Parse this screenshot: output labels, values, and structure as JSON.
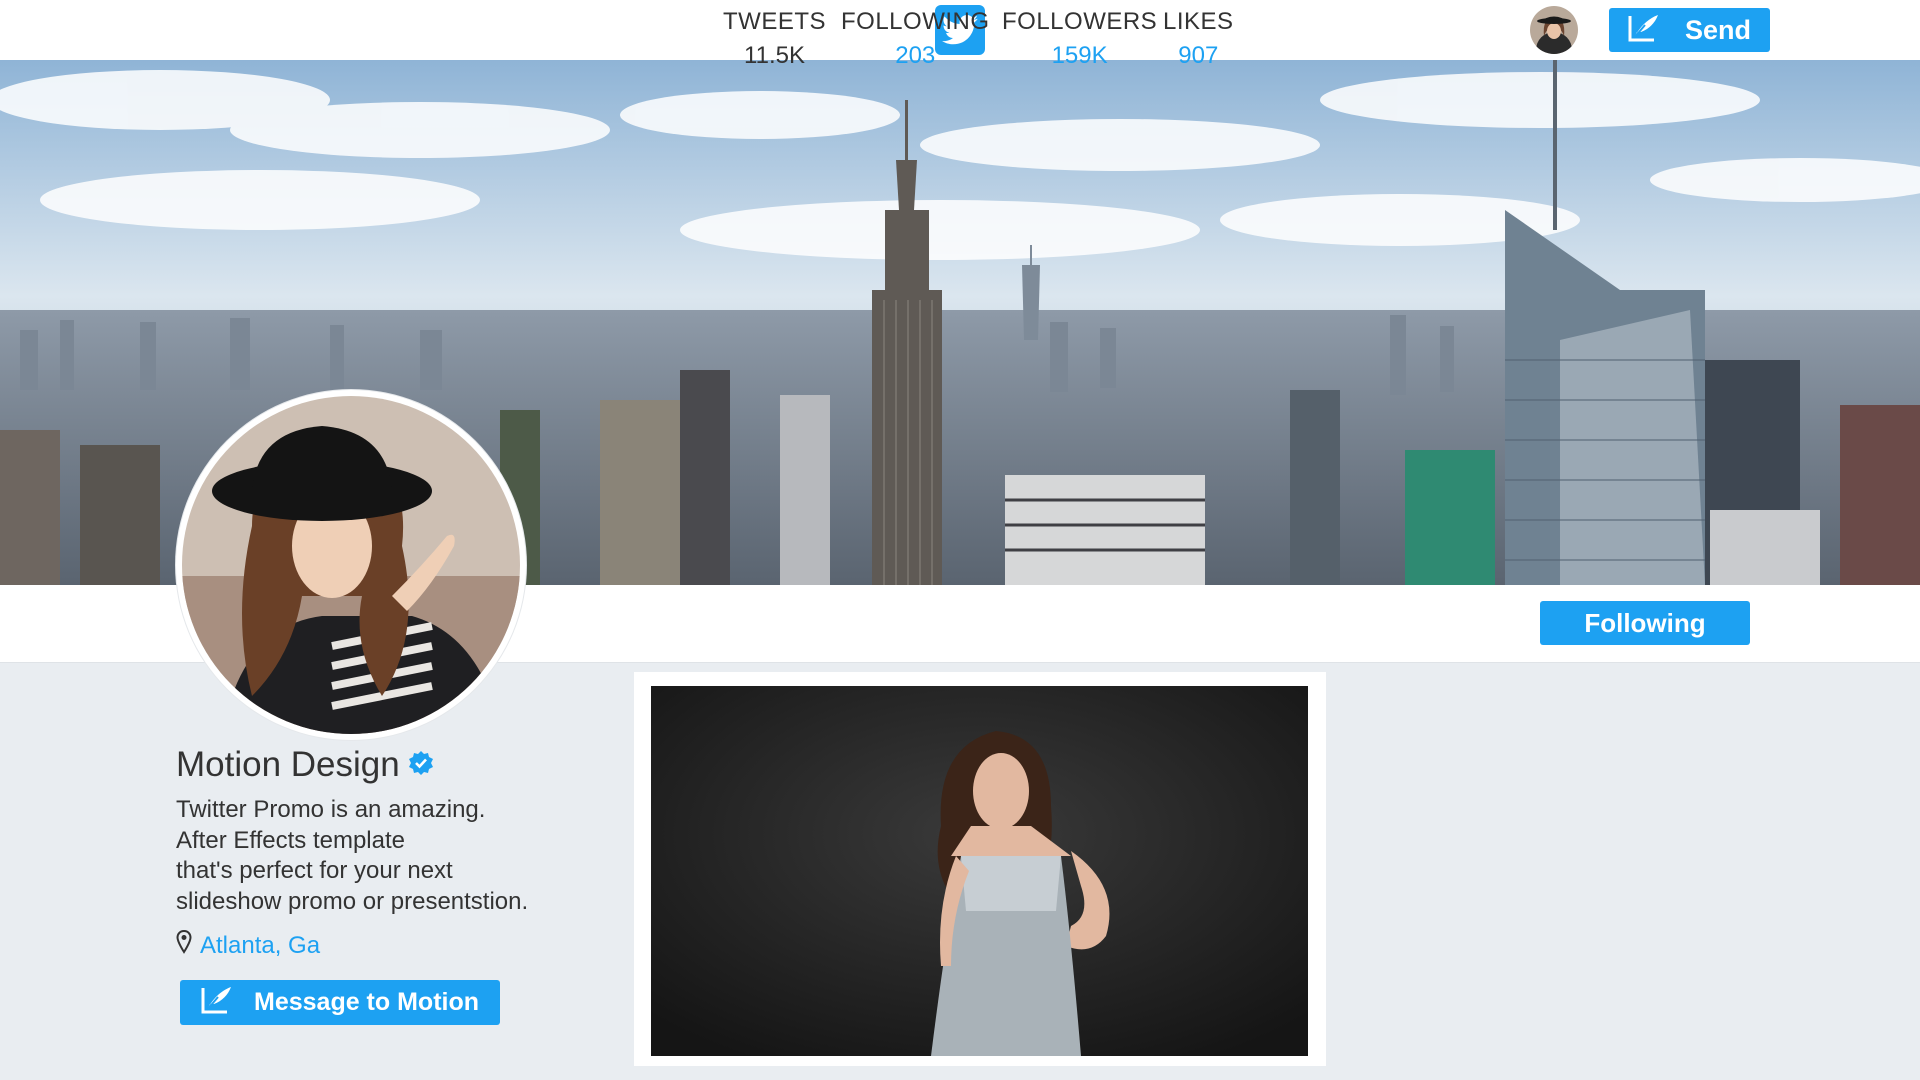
{
  "header": {
    "logo_icon": "twitter-bird-icon",
    "send_label": "Send",
    "send_icon": "compose-feather-icon",
    "avatar_icon": "user-avatar"
  },
  "stats": [
    {
      "label": "TWEETS",
      "value": "11.5K"
    },
    {
      "label": "FOLLOWING",
      "value": "203"
    },
    {
      "label": "FOLLOWERS",
      "value": "159K"
    },
    {
      "label": "LIKES",
      "value": "907"
    }
  ],
  "follow_button": {
    "label": "Following"
  },
  "profile": {
    "name": "Motion Design",
    "verified_icon": "verified-badge-icon",
    "bio": [
      "Twitter Promo is an amazing.",
      "After Effects template",
      "that's perfect for your next",
      "slideshow promo or presentstion."
    ],
    "location": "Atlanta, Ga",
    "location_icon": "map-pin-icon",
    "message_button": "Message to Motion"
  },
  "colors": {
    "accent": "#1da1f2",
    "background": "#e9edf1",
    "text": "#333333"
  }
}
